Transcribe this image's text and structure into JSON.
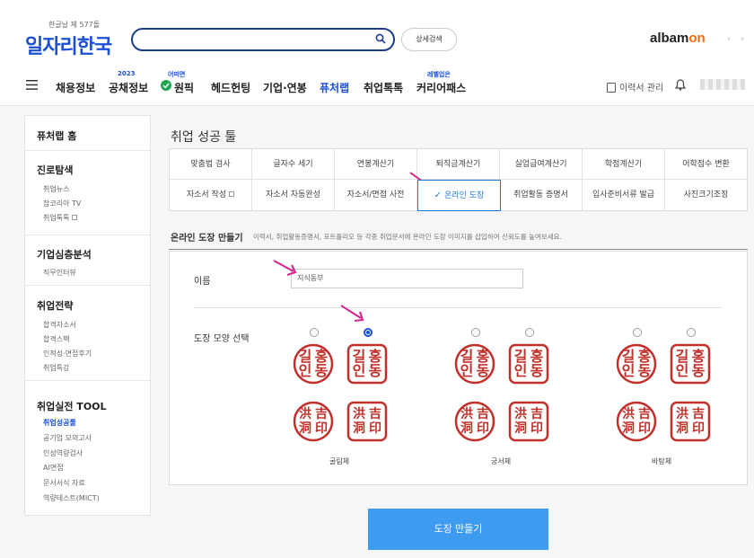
{
  "header": {
    "logo_tag": "한글날 제 577돌",
    "logo": "일자리한국",
    "search": {
      "value": "",
      "placeholder": ""
    },
    "advanced_search": "상세검색",
    "partner_logo_main": "albam",
    "partner_logo_accent": "on",
    "nav_arrows": "‹ ›",
    "nav": [
      {
        "label": "채용정보",
        "sup": ""
      },
      {
        "label": "공채정보",
        "sup": "2023"
      },
      {
        "label": "원픽",
        "sup": "어떠면"
      },
      {
        "label": "헤드헌팅",
        "sup": ""
      },
      {
        "label": "기업·연봉",
        "sup": ""
      },
      {
        "label": "퓨처랩",
        "sup": ""
      },
      {
        "label": "취업톡톡",
        "sup": ""
      },
      {
        "label": "커리어패스",
        "sup": "레벨업은"
      }
    ],
    "resume_manage": "이력서 관리",
    "accent_color": "#1a4fd6"
  },
  "sidebar": {
    "sections": [
      {
        "title": "퓨처랩 홈",
        "links": []
      },
      {
        "title": "진로탐색",
        "links": [
          "취업뉴스",
          "잡코리아 TV",
          "취업톡톡"
        ]
      },
      {
        "title": "기업심층분석",
        "links": [
          "직무인터뷰"
        ]
      },
      {
        "title": "취업전략",
        "links": [
          "합격자소서",
          "합격스펙",
          "인적성·면접후기",
          "취업특강"
        ]
      },
      {
        "title": "취업실전 TOOL",
        "links": [
          "취업성공툴",
          "공기업 모의고사",
          "인성역량검사",
          "AI면접",
          "문서서식 자료",
          "역량테스트(MICT)"
        ]
      }
    ]
  },
  "main": {
    "page_title": "취업 성공 툴",
    "tools_row1": [
      "맞춤법 검사",
      "글자수 세기",
      "연봉계산기",
      "퇴직금계산기",
      "실업급여계산기",
      "학점계산기",
      "어학점수 변환"
    ],
    "tools_row2": [
      "자소서 작성",
      "자소서 자동완성",
      "자소서/면접 사전",
      "온라인 도장",
      "취업활동 증명서",
      "입사준비서류 발급",
      "사진크기조정"
    ],
    "active_tool": "온라인 도장",
    "section_title": "온라인 도장 만들기",
    "section_desc": "이력서, 취업활동증명서, 포트폴리오 등 각종 취업문서에 온라인 도장 이미지를 삽입하여 신뢰도를 높여보세요.",
    "name_label": "이름",
    "name_value": "지식동부",
    "shape_label": "도장 모양 선택",
    "font_groups": [
      "굴림체",
      "궁서체",
      "바탕체"
    ],
    "seal_hangul": [
      "홍",
      "길",
      "동",
      "인"
    ],
    "seal_hanja": [
      "洪",
      "吉",
      "洞",
      "印"
    ],
    "selected_option": 2,
    "make_button": "도장 만들기",
    "seal_color": "#c0312b",
    "button_color": "#3d9cf0"
  }
}
